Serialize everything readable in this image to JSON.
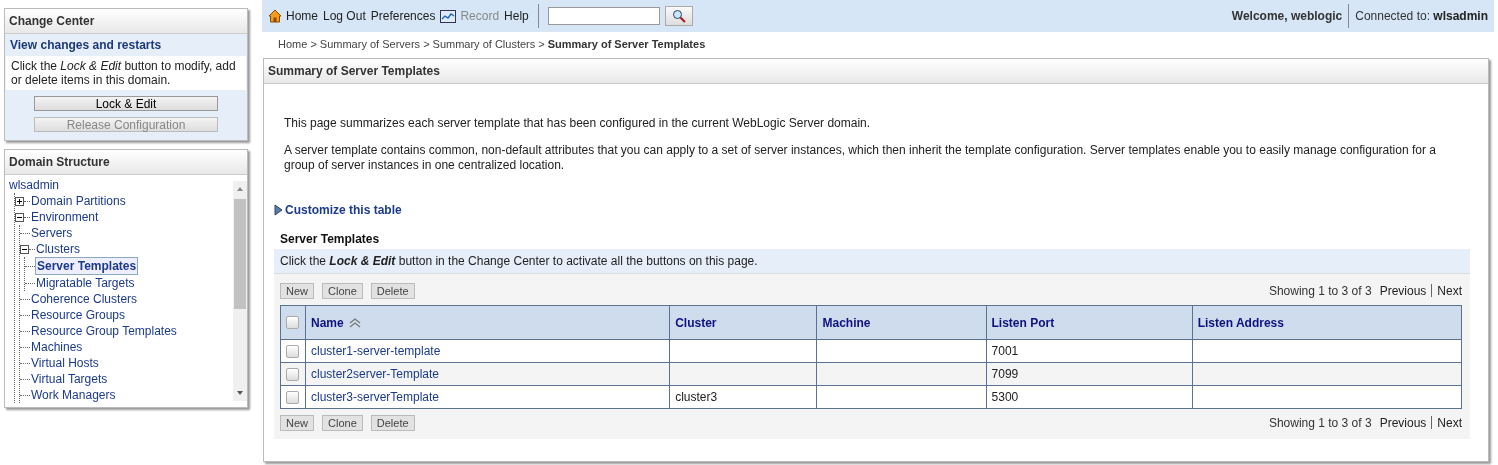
{
  "change_center": {
    "title": "Change Center",
    "subtitle": "View changes and restarts",
    "message": "Click the *Lock & Edit* button to modify, add or delete items in this domain.",
    "buttons": [
      {
        "label": "Lock & Edit",
        "disabled": false
      },
      {
        "label": "Release Configuration",
        "disabled": true
      }
    ]
  },
  "domain_structure": {
    "title": "Domain Structure",
    "root": "wlsadmin",
    "items": [
      {
        "label": "Domain Partitions",
        "expanded": false,
        "selected": false
      },
      {
        "label": "Environment",
        "expanded": true,
        "selected": false,
        "children": [
          {
            "label": "Servers",
            "selected": false
          },
          {
            "label": "Clusters",
            "expanded": true,
            "selected": false,
            "children": [
              {
                "label": "Server Templates",
                "selected": true
              },
              {
                "label": "Migratable Targets",
                "selected": false
              }
            ]
          },
          {
            "label": "Coherence Clusters",
            "selected": false
          },
          {
            "label": "Resource Groups",
            "selected": false
          },
          {
            "label": "Resource Group Templates",
            "selected": false
          },
          {
            "label": "Machines",
            "selected": false
          },
          {
            "label": "Virtual Hosts",
            "selected": false
          },
          {
            "label": "Virtual Targets",
            "selected": false
          },
          {
            "label": "Work Managers",
            "selected": false
          }
        ]
      }
    ]
  },
  "toolbar": {
    "links": [
      {
        "label": "Home",
        "kind": "home",
        "disabled": false
      },
      {
        "label": "Log Out",
        "kind": "link",
        "disabled": false
      },
      {
        "label": "Preferences",
        "kind": "link",
        "disabled": false
      },
      {
        "label": "Record",
        "kind": "record",
        "disabled": true
      },
      {
        "label": "Help",
        "kind": "link",
        "disabled": false
      }
    ],
    "welcome": "Welcome, weblogic",
    "connected_label": "Connected to:",
    "connected_value": "wlsadmin"
  },
  "breadcrumb": [
    {
      "label": "Home >",
      "current": false
    },
    {
      "label": "Summary of Servers >",
      "current": false
    },
    {
      "label": "Summary of Clusters >",
      "current": false
    },
    {
      "label": "Summary of Server Templates",
      "current": true
    }
  ],
  "page": {
    "title": "Summary of Server Templates",
    "paragraphs": [
      "This page summarizes each server template that has been configured in the current WebLogic Server domain.",
      "A server template contains common, non-default attributes that you can apply to a set of server instances, which then inherit the template configuration. Server templates enable you to easily manage configuration for a group of server instances in one centralized location."
    ],
    "customize_link": "Customize this table",
    "table_title": "Server Templates",
    "notice": "Click the **Lock & Edit** button in the Change Center to activate all the buttons on this page.",
    "top_bar": {
      "actions": [
        {
          "label": "New",
          "disabled": true
        },
        {
          "label": "Clone",
          "disabled": true
        },
        {
          "label": "Delete",
          "disabled": true
        }
      ],
      "paging": {
        "showing": "Showing 1 to 3 of 3",
        "previous": "Previous",
        "next": "Next"
      }
    },
    "bottom_bar": {
      "actions": [
        {
          "label": "New",
          "disabled": true
        },
        {
          "label": "Clone",
          "disabled": true
        },
        {
          "label": "Delete",
          "disabled": true
        }
      ],
      "paging": {
        "showing": "Showing 1 to 3 of 3",
        "previous": "Previous",
        "next": "Next"
      }
    },
    "table": {
      "header_checked": false,
      "columns": [
        {
          "label": "Name",
          "sorted": true
        },
        {
          "label": "Cluster",
          "sorted": false
        },
        {
          "label": "Machine",
          "sorted": false
        },
        {
          "label": "Listen Port",
          "sorted": false
        },
        {
          "label": "Listen Address",
          "sorted": false
        }
      ],
      "rows": [
        {
          "checked": false,
          "cells": [
            "cluster1-server-template",
            "",
            "",
            "7001",
            ""
          ]
        },
        {
          "checked": false,
          "cells": [
            "cluster2server-Template",
            "",
            "",
            "7099",
            ""
          ]
        },
        {
          "checked": false,
          "cells": [
            "cluster3-serverTemplate",
            "cluster3",
            "",
            "5300",
            ""
          ]
        }
      ]
    }
  }
}
